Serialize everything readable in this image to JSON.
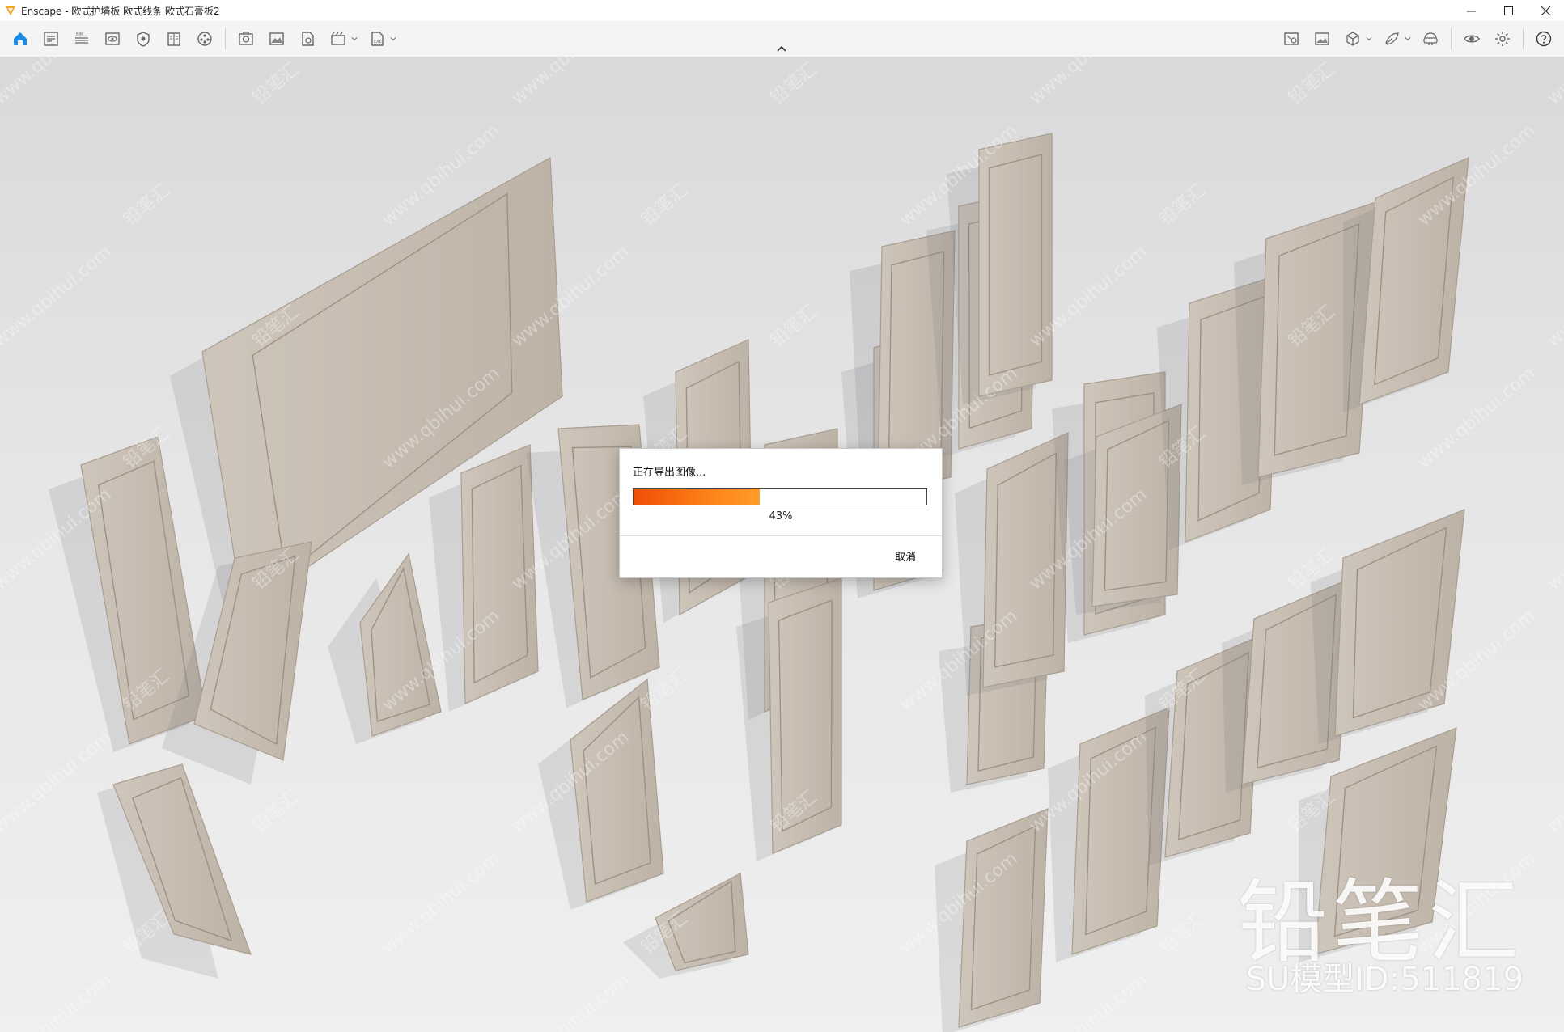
{
  "window": {
    "title": "Enscape - 欧式护墙板 欧式线条 欧式石膏板2",
    "controls": [
      "minimize",
      "maximize",
      "close"
    ]
  },
  "toolbar": {
    "left_icons": [
      "home-icon",
      "sketch-icon",
      "bim-icon",
      "view-icon",
      "visual-settings-icon",
      "book-icon",
      "asset-library-icon",
      "capture-icon",
      "screenshot-icon",
      "render-icon",
      "video-editor-icon",
      "export-icon"
    ],
    "right_icons": [
      "views-icon",
      "image-gallery-icon",
      "cube-icon",
      "feedback-icon",
      "vr-icon",
      "eye-icon",
      "settings-icon",
      "help-icon"
    ],
    "accent": "#1a8ae6"
  },
  "dialog": {
    "message": "正在导出图像...",
    "progress": 0.43,
    "progress_label": "43%",
    "cancel_label": "取消",
    "fill_color": "#f26a10"
  },
  "watermark": {
    "brand": "铅笔汇",
    "model_id": "SU模型ID:511819",
    "repeating": "www.qbihui.com",
    "repeating_cn": "铅笔汇"
  }
}
